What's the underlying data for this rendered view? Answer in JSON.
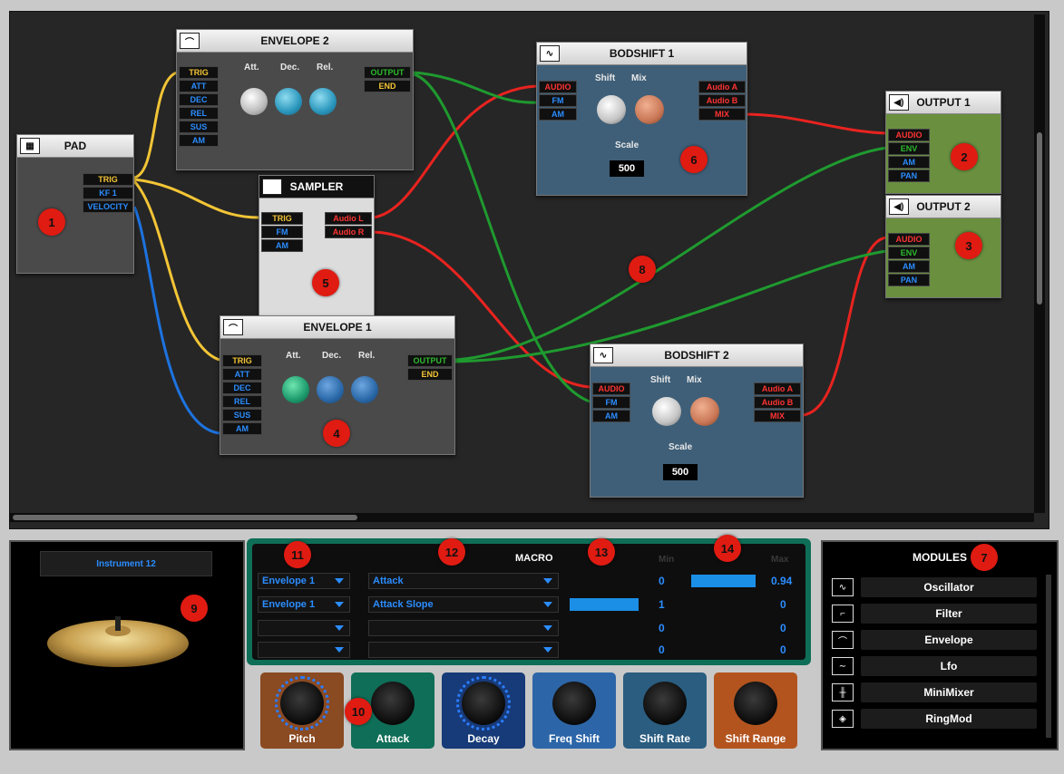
{
  "modules": {
    "pad": {
      "title": "PAD",
      "icon": "pad-icon",
      "outputs": [
        "TRIG",
        "KF 1",
        "VELOCITY"
      ]
    },
    "envelope2": {
      "title": "ENVELOPE 2",
      "icon": "envelope-icon",
      "inputs": [
        "TRIG",
        "ATT",
        "DEC",
        "REL",
        "SUS",
        "AM"
      ],
      "knob_labels": [
        "Att.",
        "Dec.",
        "Rel."
      ],
      "outputs": [
        "OUTPUT",
        "END"
      ]
    },
    "sampler": {
      "title": "SAMPLER",
      "icon": "sampler-icon",
      "inputs": [
        "TRIG",
        "FM",
        "AM"
      ],
      "outputs": [
        "Audio L",
        "Audio R"
      ]
    },
    "envelope1": {
      "title": "ENVELOPE 1",
      "icon": "envelope-icon",
      "inputs": [
        "TRIG",
        "ATT",
        "DEC",
        "REL",
        "SUS",
        "AM"
      ],
      "knob_labels": [
        "Att.",
        "Dec.",
        "Rel."
      ],
      "outputs": [
        "OUTPUT",
        "END"
      ]
    },
    "bodshift1": {
      "title": "BODSHIFT 1",
      "icon": "bodshift-icon",
      "inputs": [
        "AUDIO",
        "FM",
        "AM"
      ],
      "knob_labels": [
        "Shift",
        "Mix"
      ],
      "outputs": [
        "Audio A",
        "Audio B",
        "MIX"
      ],
      "scale_label": "Scale",
      "scale_value": "500"
    },
    "bodshift2": {
      "title": "BODSHIFT 2",
      "icon": "bodshift-icon",
      "inputs": [
        "AUDIO",
        "FM",
        "AM"
      ],
      "knob_labels": [
        "Shift",
        "Mix"
      ],
      "outputs": [
        "Audio A",
        "Audio B",
        "MIX"
      ],
      "scale_label": "Scale",
      "scale_value": "500"
    },
    "output1": {
      "title": "OUTPUT 1",
      "icon": "speaker-icon",
      "inputs": [
        "AUDIO",
        "ENV",
        "AM",
        "PAN"
      ]
    },
    "output2": {
      "title": "OUTPUT 2",
      "icon": "speaker-icon",
      "inputs": [
        "AUDIO",
        "ENV",
        "AM",
        "PAN"
      ]
    }
  },
  "badges": [
    "1",
    "2",
    "3",
    "4",
    "5",
    "6",
    "7",
    "8",
    "9",
    "10",
    "11",
    "12",
    "13",
    "14"
  ],
  "instrument": {
    "name": "Instrument 12"
  },
  "macro": {
    "title": "MACRO",
    "min_label": "Min",
    "max_label": "Max",
    "rows": [
      {
        "module": "Envelope 1",
        "param": "Attack",
        "min": "0",
        "max": "0.94",
        "level": 0.94
      },
      {
        "module": "Envelope 1",
        "param": "Attack Slope",
        "min": "1",
        "max": "0",
        "level": 1.0
      },
      {
        "module": "",
        "param": "",
        "min": "0",
        "max": "0",
        "level": 0
      },
      {
        "module": "",
        "param": "",
        "min": "0",
        "max": "0",
        "level": 0
      }
    ]
  },
  "macro_knobs": [
    {
      "label": "Pitch",
      "color": "#8a4a22"
    },
    {
      "label": "Attack",
      "color": "#0f6e57"
    },
    {
      "label": "Decay",
      "color": "#173a78"
    },
    {
      "label": "Freq Shift",
      "color": "#2d66a8"
    },
    {
      "label": "Shift Rate",
      "color": "#2a5d80"
    },
    {
      "label": "Shift Range",
      "color": "#b3541f"
    }
  ],
  "modules_panel": {
    "title": "MODULES",
    "items": [
      {
        "label": "Oscillator",
        "icon": "oscillator-icon"
      },
      {
        "label": "Filter",
        "icon": "filter-icon"
      },
      {
        "label": "Envelope",
        "icon": "envelope-icon"
      },
      {
        "label": "Lfo",
        "icon": "lfo-icon"
      },
      {
        "label": "MiniMixer",
        "icon": "minimixer-icon"
      },
      {
        "label": "RingMod",
        "icon": "ringmod-icon"
      }
    ]
  },
  "colors": {
    "trig": "#f3c536",
    "mod": "#2b8dff",
    "audio": "#ff3333",
    "env": "#2dba2d",
    "badge": "#e01b12"
  }
}
